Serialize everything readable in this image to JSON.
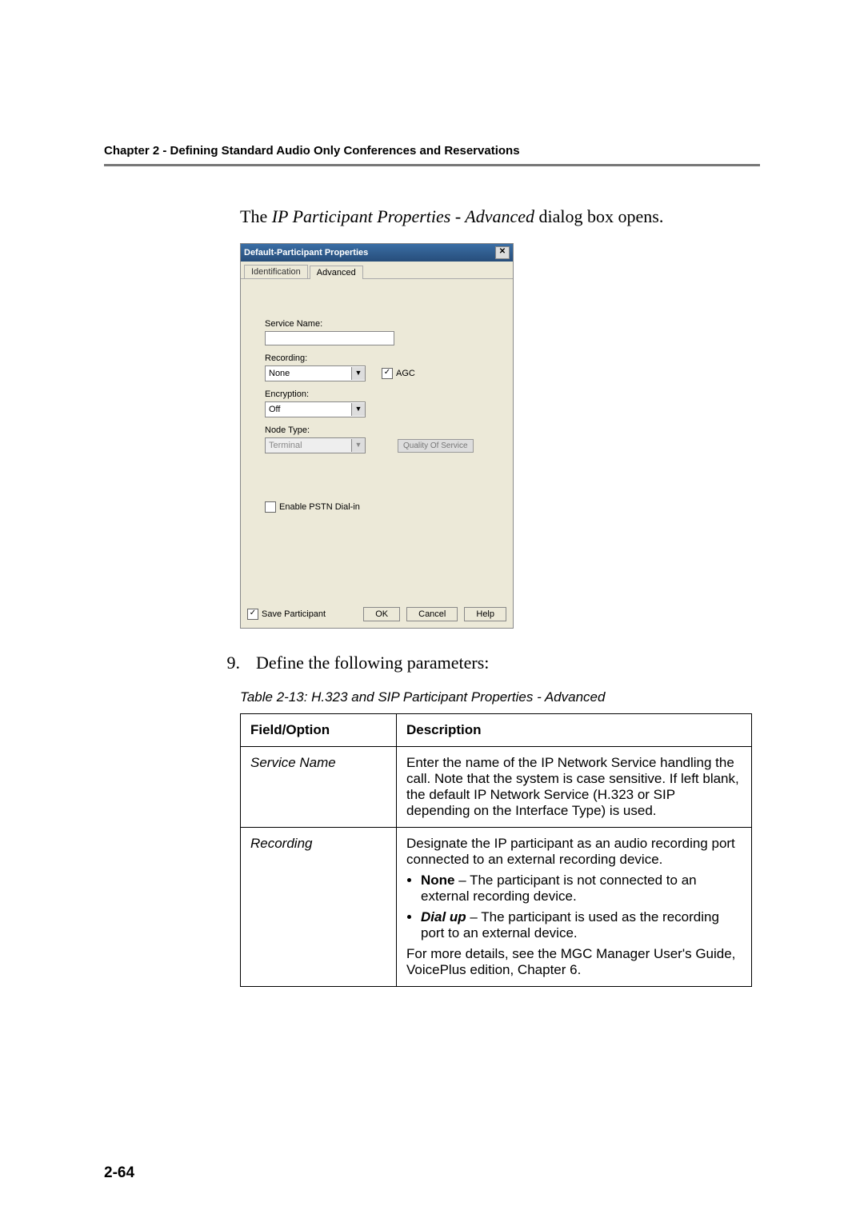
{
  "header": {
    "chapter": "Chapter 2 - Defining Standard Audio Only Conferences and Reservations"
  },
  "intro": {
    "prefix": "The ",
    "italic": "IP Participant Properties - Advanced",
    "suffix": " dialog box opens."
  },
  "dialog": {
    "title": "Default-Participant Properties",
    "close_glyph": "✕",
    "tabs": {
      "id": "Identification",
      "adv": "Advanced"
    },
    "labels": {
      "service_name": "Service Name:",
      "recording": "Recording:",
      "encryption": "Encryption:",
      "node_type": "Node Type:",
      "agc": "AGC",
      "qos": "Quality Of Service",
      "pstn": "Enable PSTN Dial-in",
      "save": "Save Participant"
    },
    "values": {
      "recording": "None",
      "encryption": "Off",
      "node_type": "Terminal"
    },
    "buttons": {
      "ok": "OK",
      "cancel": "Cancel",
      "help": "Help"
    },
    "arrow": "▼",
    "check_glyph": "✓"
  },
  "step": {
    "num": "9.",
    "text": "Define the following parameters:"
  },
  "table_caption": "Table 2-13: H.323 and SIP Participant Properties - Advanced",
  "table": {
    "h1": "Field/Option",
    "h2": "Description",
    "rows": [
      {
        "field": "Service Name",
        "desc": "Enter the name of the IP Network Service handling the call. Note that the system is case sensitive. If left blank, the default IP Network Service (H.323 or SIP depending on the Interface Type) is used."
      },
      {
        "field": "Recording",
        "lead": "Designate the IP participant as an audio recording port connected to an external recording device.",
        "bullets": [
          {
            "b": "None",
            "t": " – The participant is not connected to an external recording device."
          },
          {
            "b": "Dial up",
            "t": " – The participant is used as the recording port to an external device."
          }
        ],
        "tail": "For more details, see the MGC Manager User's Guide, VoicePlus edition, Chapter 6."
      }
    ]
  },
  "page_number": "2-64"
}
